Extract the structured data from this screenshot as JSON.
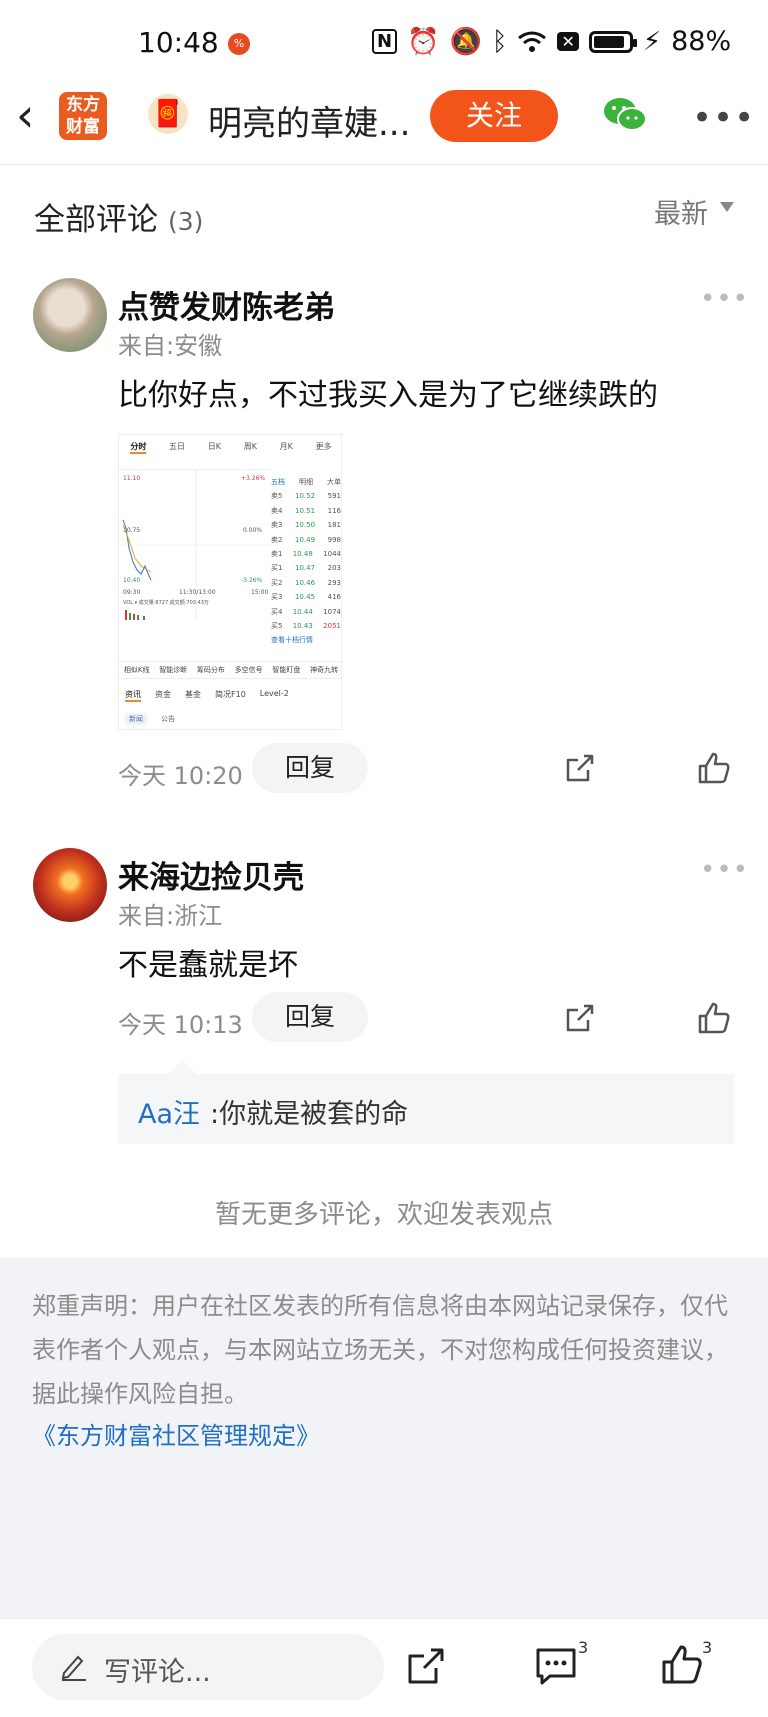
{
  "status_bar": {
    "time": "10:48",
    "notif": "%",
    "battery": "88%",
    "battery_level": 0.88
  },
  "header": {
    "logo_text": "东方\n财富",
    "title": "明亮的章婕...",
    "follow_label": "关注"
  },
  "comments_section": {
    "title": "全部评论",
    "count": "(3)",
    "sort_label": "最新"
  },
  "comments": [
    {
      "username": "点赞发财陈老弟",
      "location": "来自:安徽",
      "text": "比你好点，不过我买入是为了它继续跌的",
      "time": "今天 10:20",
      "reply_label": "回复"
    },
    {
      "username": "来海边捡贝壳",
      "location": "来自:浙江",
      "text": "不是蠢就是坏",
      "time": "今天 10:13",
      "reply_label": "回复",
      "sub_reply": {
        "user": "Aa汪",
        "text": ":你就是被套的命"
      }
    }
  ],
  "stock_image": {
    "tabs": [
      "分时",
      "五日",
      "日K",
      "周K",
      "月K",
      "更多"
    ],
    "book_header": [
      "五档",
      "明细",
      "大单"
    ],
    "order_book": [
      {
        "label": "卖5",
        "price": "10.52",
        "vol": "591"
      },
      {
        "label": "卖4",
        "price": "10.51",
        "vol": "116"
      },
      {
        "label": "卖3",
        "price": "10.50",
        "vol": "181"
      },
      {
        "label": "卖2",
        "price": "10.49",
        "vol": "998"
      },
      {
        "label": "卖1",
        "price": "10.48",
        "vol": "1044"
      },
      {
        "label": "买1",
        "price": "10.47",
        "vol": "203"
      },
      {
        "label": "买2",
        "price": "10.46",
        "vol": "293"
      },
      {
        "label": "买3",
        "price": "10.45",
        "vol": "416"
      },
      {
        "label": "买4",
        "price": "10.44",
        "vol": "1074"
      },
      {
        "label": "买5",
        "price": "10.43",
        "vol": "2051"
      }
    ],
    "chart_labels": {
      "high": "11.10",
      "mid": "10.75",
      "low": "10.40",
      "pct_up": "+3.26%",
      "pct_mid": "0.00%",
      "pct_down": "-3.26%",
      "t_start": "09:30",
      "t_mid": "11:30/13:00",
      "t_end": "15:00"
    },
    "volume_label": "VOL ▾  成交量:8727  成交额:703.43万",
    "more_link": "查看十档行情",
    "buttons": [
      "相似K线",
      "智能诊断",
      "筹码分布",
      "多空信号",
      "智能盯盘",
      "神奇九转"
    ],
    "tabs2": [
      "资讯",
      "资金",
      "基金",
      "简况F10",
      "Level-2"
    ],
    "sub_tabs": [
      "新闻",
      "公告"
    ]
  },
  "no_more_text": "暂无更多评论，欢迎发表观点",
  "disclaimer": {
    "text": "郑重声明：用户在社区发表的所有信息将由本网站记录保存，仅代表作者个人观点，与本网站立场无关，不对您构成任何投资建议，据此操作风险自担。",
    "link": "《东方财富社区管理规定》"
  },
  "bottom_bar": {
    "comment_placeholder": "写评论...",
    "comment_count": "3",
    "like_count": "3"
  },
  "colors": {
    "accent": "#f2541a",
    "link": "#1f6fc4",
    "logo": "#ea5b20"
  }
}
